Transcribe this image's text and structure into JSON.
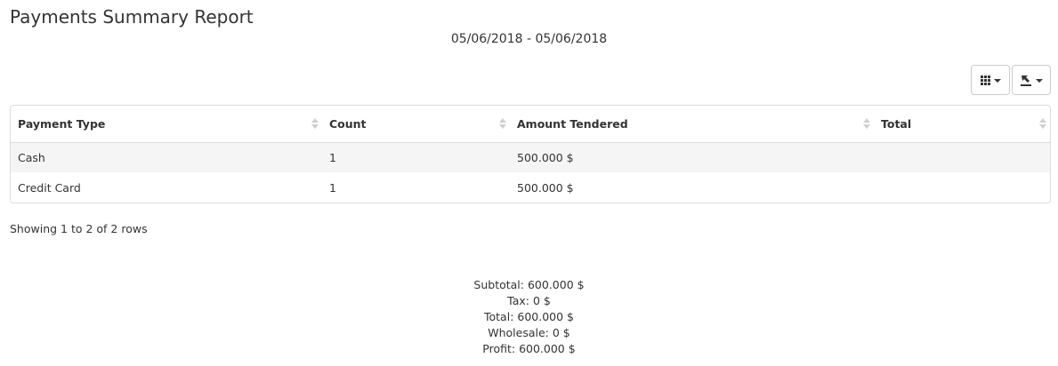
{
  "header": {
    "title": "Payments Summary Report",
    "date_range": "05/06/2018 - 05/06/2018"
  },
  "toolbar": {
    "columns_button_icon": "grid-icon",
    "export_button_icon": "export-icon"
  },
  "table": {
    "columns": [
      "Payment Type",
      "Count",
      "Amount Tendered",
      "Total"
    ],
    "rows": [
      {
        "payment_type": "Cash",
        "count": "1",
        "amount_tendered": "500.000 $",
        "total": ""
      },
      {
        "payment_type": "Credit Card",
        "count": "1",
        "amount_tendered": "500.000 $",
        "total": ""
      }
    ],
    "pagination_info": "Showing 1 to 2 of 2 rows"
  },
  "summary": {
    "subtotal": "Subtotal: 600.000 $",
    "tax": "Tax: 0 $",
    "total": "Total: 600.000 $",
    "wholesale": "Wholesale: 0 $",
    "profit": "Profit: 600.000 $"
  }
}
